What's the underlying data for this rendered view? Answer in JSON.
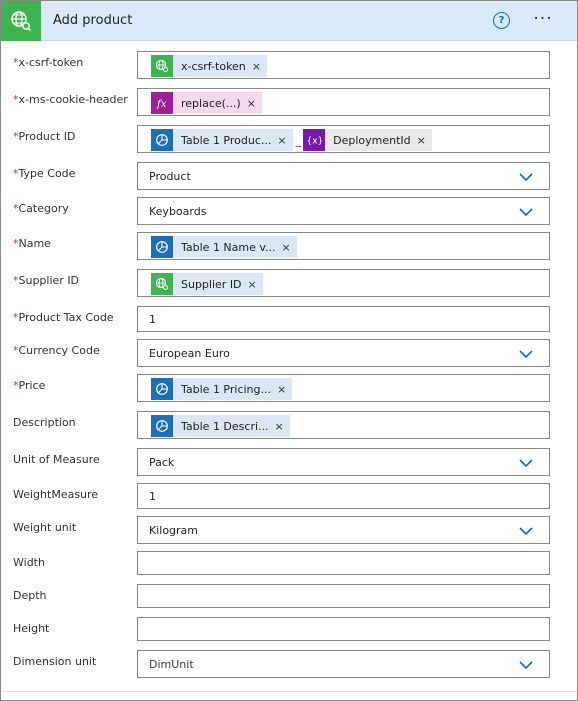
{
  "header": {
    "title": "Add product",
    "help_label": "?",
    "more_label": "···",
    "icon_color": "#3fb34f"
  },
  "colors": {
    "accent": "#0f6cbd",
    "required": "#c4314b",
    "connector_green": "#3fb34f",
    "excel_blue": "#1e6fb8",
    "expression_purple": "#9e1f96",
    "variable_purple": "#7719aa"
  },
  "fields": {
    "x_csrf_token": {
      "required": "*",
      "label": "x-csrf-token",
      "tokens": [
        {
          "icon": "connector-globe-icon",
          "text": "x-csrf-token",
          "remove": "×"
        }
      ]
    },
    "x_ms_cookie_header": {
      "required": "*",
      "label": "x-ms-cookie-header",
      "tokens": [
        {
          "icon": "expression-fx-icon",
          "text": "replace(...)",
          "remove": "×"
        }
      ]
    },
    "product_id": {
      "required": "*",
      "label": "Product ID",
      "tokens": [
        {
          "icon": "excel-table-icon",
          "text": "Table 1 Produc...",
          "remove": "×"
        },
        {
          "icon": "variable-icon",
          "text": "DeploymentId",
          "remove": "×"
        }
      ],
      "separator": "_"
    },
    "type_code": {
      "required": "*",
      "label": "Type Code",
      "value": "Product"
    },
    "category": {
      "required": "*",
      "label": "Category",
      "value": "Keyboards"
    },
    "name": {
      "required": "*",
      "label": "Name",
      "tokens": [
        {
          "icon": "excel-table-icon",
          "text": "Table 1 Name v...",
          "remove": "×"
        }
      ]
    },
    "supplier_id": {
      "required": "*",
      "label": "Supplier ID",
      "tokens": [
        {
          "icon": "connector-globe-icon",
          "text": "Supplier ID",
          "remove": "×"
        }
      ]
    },
    "product_tax_code": {
      "required": "*",
      "label": "Product Tax Code",
      "value": "1"
    },
    "currency_code": {
      "required": "*",
      "label": "Currency Code",
      "value": "European Euro"
    },
    "price": {
      "required": "*",
      "label": "Price",
      "tokens": [
        {
          "icon": "excel-table-icon",
          "text": "Table 1 Pricing...",
          "remove": "×"
        }
      ]
    },
    "description": {
      "label": "Description",
      "tokens": [
        {
          "icon": "excel-table-icon",
          "text": "Table 1 Descri...",
          "remove": "×"
        }
      ]
    },
    "unit_of_measure": {
      "label": "Unit of Measure",
      "value": "Pack"
    },
    "weight_measure": {
      "label": "WeightMeasure",
      "value": "1"
    },
    "weight_unit": {
      "label": "Weight unit",
      "value": "Kilogram"
    },
    "width": {
      "label": "Width",
      "value": ""
    },
    "depth": {
      "label": "Depth",
      "value": ""
    },
    "height": {
      "label": "Height",
      "value": ""
    },
    "dimension_unit": {
      "label": "Dimension unit",
      "value": "DimUnit"
    }
  }
}
